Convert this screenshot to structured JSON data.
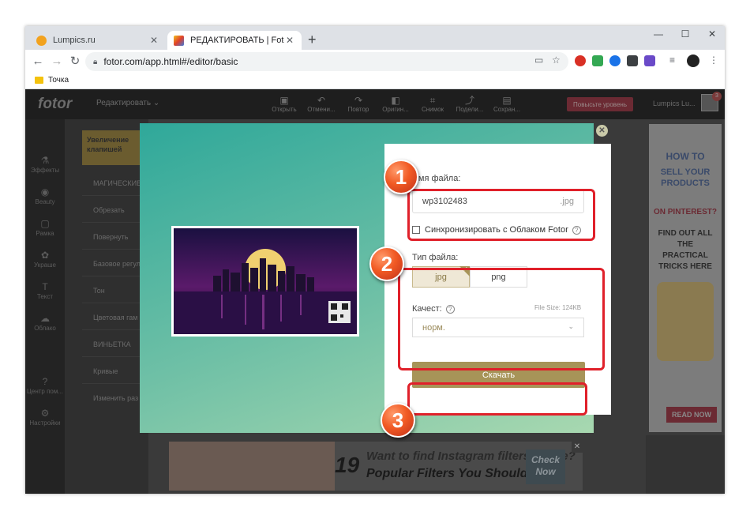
{
  "browser": {
    "tabs": [
      {
        "title": "Lumpics.ru",
        "favicon_color": "#f2a21e"
      },
      {
        "title": "РЕДАКТИРОВАТЬ | Fotor",
        "favicon_color": "#e0402a"
      }
    ],
    "url": "fotor.com/app.html#/editor/basic",
    "bookmark": "Точка",
    "minimize": "—",
    "maximize": "☐",
    "close": "✕"
  },
  "fotor": {
    "logo": "fotor",
    "edit_menu": "Редактировать",
    "top_tools": [
      "Открыть",
      "Отмени...",
      "Повтор",
      "Оригин...",
      "Снимок",
      "Подели...",
      "Сохран..."
    ],
    "upgrade": "Повысьте уровень",
    "user": "Lumpics Lu...",
    "notif_count": "3",
    "left_rail": [
      "Эффекты",
      "Beauty",
      "Рамка",
      "Украше",
      "Текст",
      "Облако",
      "Центр пом...",
      "Настройки"
    ],
    "panel_promo": "Увеличение клапишей",
    "panel_items": [
      "МАГИЧЕСКИЕ",
      "Обрезать",
      "Повернуть",
      "Базовое регул",
      "Тон",
      "Цветовая гам",
      "ВИНЬЕТКА",
      "Кривые",
      "Изменить раз"
    ]
  },
  "ad_right": {
    "line1": "HOW TO",
    "line2": "SELL YOUR PRODUCTS",
    "line3": "ON PINTEREST?",
    "line4": "FIND OUT ALL THE PRACTICAL TRICKS HERE",
    "cta": "READ NOW"
  },
  "ad_bottom": {
    "number": "19",
    "line1": "Want to find Instagram filters online?",
    "line2": "Popular Filters You Should Try",
    "cta_line1": "Check",
    "cta_line2": "Now",
    "close": "✕"
  },
  "dialog": {
    "close": "✕",
    "filename_label": "Имя файла:",
    "filename_value": "wp3102483",
    "filename_ext": ".jpg",
    "sync_label": "Синхронизировать с Облаком Fotor",
    "sync_checked": false,
    "filetype_label": "Тип файла:",
    "filetypes": [
      "jpg",
      "png"
    ],
    "filetype_selected": "jpg",
    "quality_label": "Качест:",
    "file_size": "File Size: 124KB",
    "quality_value": "норм.",
    "download_label": "Скачать"
  },
  "annotations": [
    "1",
    "2",
    "3"
  ],
  "colors": {
    "accent_gold": "#a79458",
    "annotation_red": "#e0202a",
    "badge_orange": "#f15a24"
  }
}
